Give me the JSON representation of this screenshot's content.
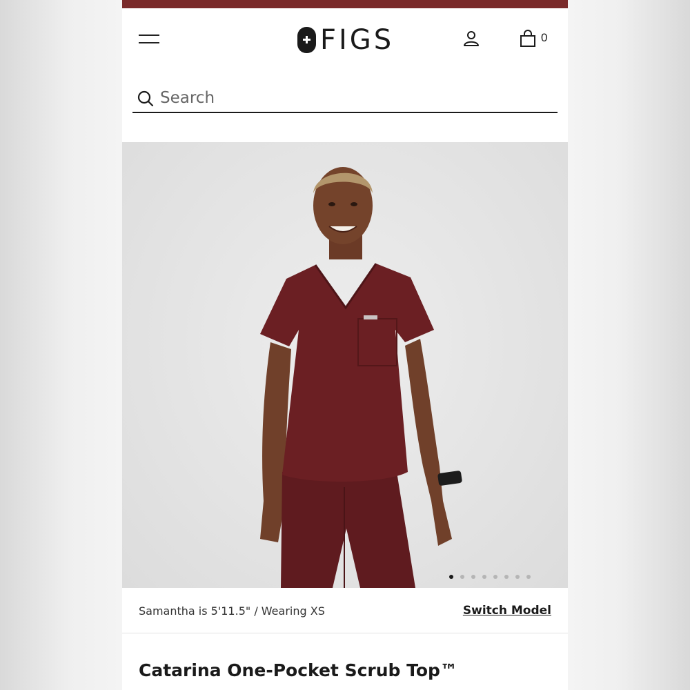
{
  "brand": {
    "name": "FIGS"
  },
  "header": {
    "cart_count": "0"
  },
  "search": {
    "placeholder": "Search"
  },
  "hero": {
    "gallery_dot_count": 8,
    "active_dot_index": 0
  },
  "model_info": {
    "text": "Samantha is 5'11.5\" / Wearing XS",
    "switch_label": "Switch Model"
  },
  "product": {
    "title": "Catarina One-Pocket Scrub Top™",
    "color_hex": "#6b1f23"
  },
  "colors": {
    "accent_strip": "#7a2a2a",
    "text": "#1a1a1a"
  }
}
